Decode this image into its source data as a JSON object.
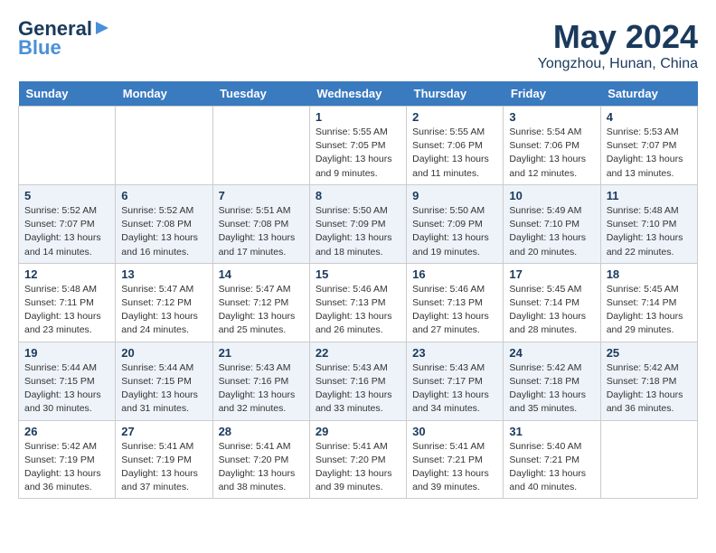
{
  "logo": {
    "line1": "General",
    "line2": "Blue"
  },
  "title": "May 2024",
  "location": "Yongzhou, Hunan, China",
  "weekdays": [
    "Sunday",
    "Monday",
    "Tuesday",
    "Wednesday",
    "Thursday",
    "Friday",
    "Saturday"
  ],
  "weeks": [
    [
      {
        "day": "",
        "info": ""
      },
      {
        "day": "",
        "info": ""
      },
      {
        "day": "",
        "info": ""
      },
      {
        "day": "1",
        "info": "Sunrise: 5:55 AM\nSunset: 7:05 PM\nDaylight: 13 hours\nand 9 minutes."
      },
      {
        "day": "2",
        "info": "Sunrise: 5:55 AM\nSunset: 7:06 PM\nDaylight: 13 hours\nand 11 minutes."
      },
      {
        "day": "3",
        "info": "Sunrise: 5:54 AM\nSunset: 7:06 PM\nDaylight: 13 hours\nand 12 minutes."
      },
      {
        "day": "4",
        "info": "Sunrise: 5:53 AM\nSunset: 7:07 PM\nDaylight: 13 hours\nand 13 minutes."
      }
    ],
    [
      {
        "day": "5",
        "info": "Sunrise: 5:52 AM\nSunset: 7:07 PM\nDaylight: 13 hours\nand 14 minutes."
      },
      {
        "day": "6",
        "info": "Sunrise: 5:52 AM\nSunset: 7:08 PM\nDaylight: 13 hours\nand 16 minutes."
      },
      {
        "day": "7",
        "info": "Sunrise: 5:51 AM\nSunset: 7:08 PM\nDaylight: 13 hours\nand 17 minutes."
      },
      {
        "day": "8",
        "info": "Sunrise: 5:50 AM\nSunset: 7:09 PM\nDaylight: 13 hours\nand 18 minutes."
      },
      {
        "day": "9",
        "info": "Sunrise: 5:50 AM\nSunset: 7:09 PM\nDaylight: 13 hours\nand 19 minutes."
      },
      {
        "day": "10",
        "info": "Sunrise: 5:49 AM\nSunset: 7:10 PM\nDaylight: 13 hours\nand 20 minutes."
      },
      {
        "day": "11",
        "info": "Sunrise: 5:48 AM\nSunset: 7:10 PM\nDaylight: 13 hours\nand 22 minutes."
      }
    ],
    [
      {
        "day": "12",
        "info": "Sunrise: 5:48 AM\nSunset: 7:11 PM\nDaylight: 13 hours\nand 23 minutes."
      },
      {
        "day": "13",
        "info": "Sunrise: 5:47 AM\nSunset: 7:12 PM\nDaylight: 13 hours\nand 24 minutes."
      },
      {
        "day": "14",
        "info": "Sunrise: 5:47 AM\nSunset: 7:12 PM\nDaylight: 13 hours\nand 25 minutes."
      },
      {
        "day": "15",
        "info": "Sunrise: 5:46 AM\nSunset: 7:13 PM\nDaylight: 13 hours\nand 26 minutes."
      },
      {
        "day": "16",
        "info": "Sunrise: 5:46 AM\nSunset: 7:13 PM\nDaylight: 13 hours\nand 27 minutes."
      },
      {
        "day": "17",
        "info": "Sunrise: 5:45 AM\nSunset: 7:14 PM\nDaylight: 13 hours\nand 28 minutes."
      },
      {
        "day": "18",
        "info": "Sunrise: 5:45 AM\nSunset: 7:14 PM\nDaylight: 13 hours\nand 29 minutes."
      }
    ],
    [
      {
        "day": "19",
        "info": "Sunrise: 5:44 AM\nSunset: 7:15 PM\nDaylight: 13 hours\nand 30 minutes."
      },
      {
        "day": "20",
        "info": "Sunrise: 5:44 AM\nSunset: 7:15 PM\nDaylight: 13 hours\nand 31 minutes."
      },
      {
        "day": "21",
        "info": "Sunrise: 5:43 AM\nSunset: 7:16 PM\nDaylight: 13 hours\nand 32 minutes."
      },
      {
        "day": "22",
        "info": "Sunrise: 5:43 AM\nSunset: 7:16 PM\nDaylight: 13 hours\nand 33 minutes."
      },
      {
        "day": "23",
        "info": "Sunrise: 5:43 AM\nSunset: 7:17 PM\nDaylight: 13 hours\nand 34 minutes."
      },
      {
        "day": "24",
        "info": "Sunrise: 5:42 AM\nSunset: 7:18 PM\nDaylight: 13 hours\nand 35 minutes."
      },
      {
        "day": "25",
        "info": "Sunrise: 5:42 AM\nSunset: 7:18 PM\nDaylight: 13 hours\nand 36 minutes."
      }
    ],
    [
      {
        "day": "26",
        "info": "Sunrise: 5:42 AM\nSunset: 7:19 PM\nDaylight: 13 hours\nand 36 minutes."
      },
      {
        "day": "27",
        "info": "Sunrise: 5:41 AM\nSunset: 7:19 PM\nDaylight: 13 hours\nand 37 minutes."
      },
      {
        "day": "28",
        "info": "Sunrise: 5:41 AM\nSunset: 7:20 PM\nDaylight: 13 hours\nand 38 minutes."
      },
      {
        "day": "29",
        "info": "Sunrise: 5:41 AM\nSunset: 7:20 PM\nDaylight: 13 hours\nand 39 minutes."
      },
      {
        "day": "30",
        "info": "Sunrise: 5:41 AM\nSunset: 7:21 PM\nDaylight: 13 hours\nand 39 minutes."
      },
      {
        "day": "31",
        "info": "Sunrise: 5:40 AM\nSunset: 7:21 PM\nDaylight: 13 hours\nand 40 minutes."
      },
      {
        "day": "",
        "info": ""
      }
    ]
  ]
}
